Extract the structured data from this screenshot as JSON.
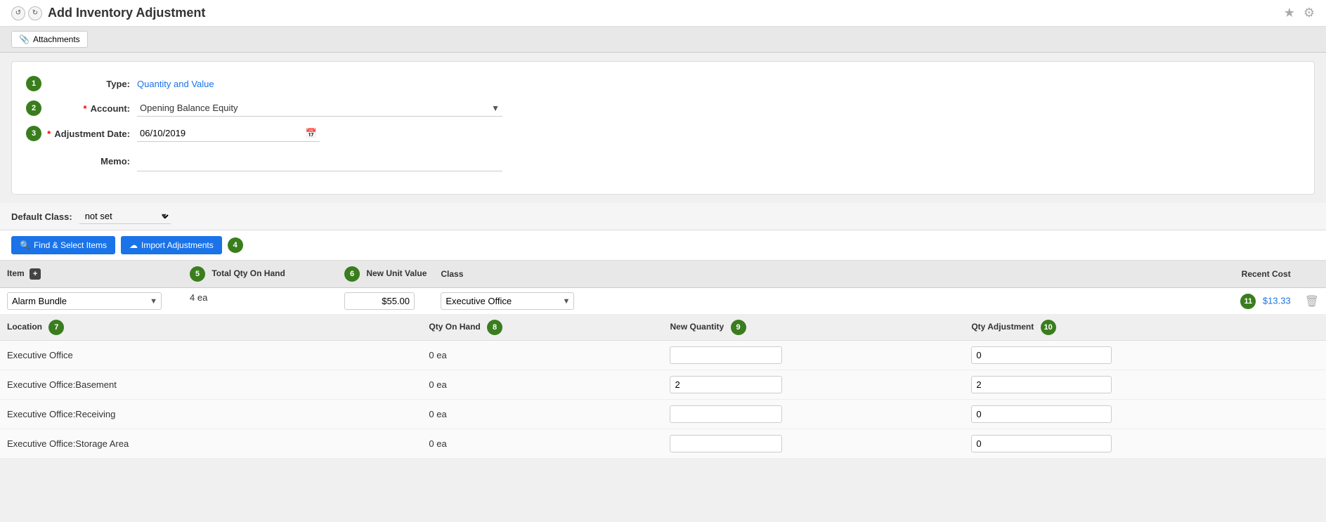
{
  "topBar": {
    "title": "Add Inventory Adjustment",
    "starIcon": "★",
    "gearIcon": "⚙"
  },
  "toolbar": {
    "attachmentsLabel": "Attachments",
    "attachmentsIcon": "📎"
  },
  "form": {
    "step1": "1",
    "typeLabel": "Type:",
    "typeValue": "Quantity and Value",
    "step2": "2",
    "accountLabel": "Account:",
    "accountValue": "Opening Balance Equity",
    "step3": "3",
    "adjustmentDateLabel": "Adjustment Date:",
    "adjustmentDateValue": "06/10/2019",
    "memoLabel": "Memo:",
    "memoValue": ""
  },
  "defaultClass": {
    "label": "Default Class:",
    "value": "not set"
  },
  "buttons": {
    "findSelectItems": "Find & Select Items",
    "importAdjustments": "Import Adjustments",
    "step4": "4"
  },
  "tableHeaders": {
    "item": "Item",
    "totalQtyOnHand": "Total Qty On Hand",
    "newUnitValue": "New Unit Value",
    "class": "Class",
    "recentCost": "Recent Cost",
    "step5": "5",
    "step6": "6"
  },
  "itemRow": {
    "itemName": "Alarm Bundle",
    "totalQty": "4 ea",
    "newUnitValue": "$55.00",
    "className": "Executive Office",
    "recentCost": "$13.33",
    "step11": "11"
  },
  "subTableHeaders": {
    "location": "Location",
    "qtyOnHand": "Qty On Hand",
    "newQuantity": "New Quantity",
    "qtyAdjustment": "Qty Adjustment",
    "step7": "7",
    "step8": "8",
    "step9": "9",
    "step10": "10"
  },
  "locationRows": [
    {
      "location": "Executive Office",
      "qtyOnHand": "0 ea",
      "newQuantity": "",
      "qtyAdjustment": "0"
    },
    {
      "location": "Executive Office:Basement",
      "qtyOnHand": "0 ea",
      "newQuantity": "2",
      "qtyAdjustment": "2"
    },
    {
      "location": "Executive Office:Receiving",
      "qtyOnHand": "0 ea",
      "newQuantity": "",
      "qtyAdjustment": "0"
    },
    {
      "location": "Executive Office:Storage Area",
      "qtyOnHand": "0 ea",
      "newQuantity": "",
      "qtyAdjustment": "0"
    }
  ]
}
